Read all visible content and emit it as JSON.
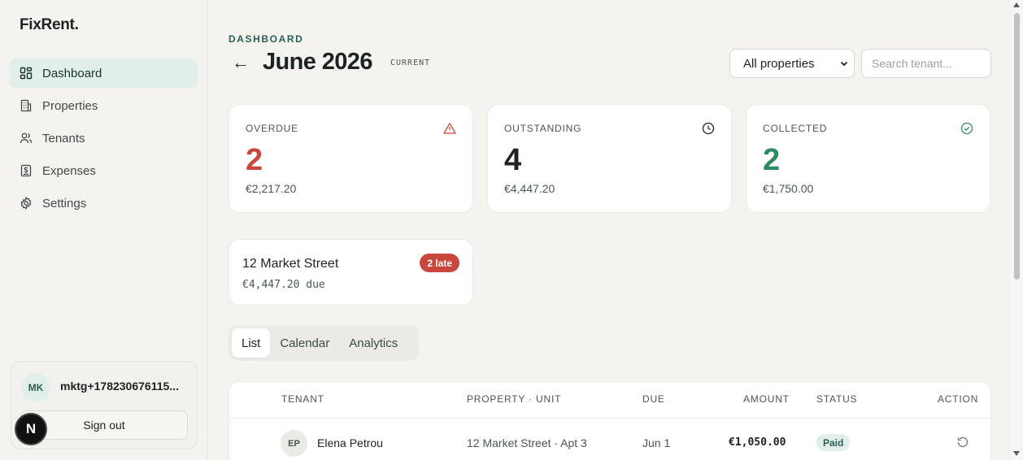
{
  "app": {
    "logo": "FixRent."
  },
  "sidebar": {
    "items": [
      {
        "label": "Dashboard",
        "icon": "dashboard-icon",
        "active": true
      },
      {
        "label": "Properties",
        "icon": "building-icon"
      },
      {
        "label": "Tenants",
        "icon": "users-icon"
      },
      {
        "label": "Expenses",
        "icon": "receipt-icon"
      },
      {
        "label": "Settings",
        "icon": "gear-icon"
      }
    ]
  },
  "user": {
    "initials": "MK",
    "email": "mktg+178230676115...",
    "signout_label": "Sign out",
    "framework_badge": "N"
  },
  "header": {
    "eyebrow": "DASHBOARD",
    "back": "←",
    "month": "June 2026",
    "current_tag": "CURRENT",
    "property_filter": "All properties",
    "search_placeholder": "Search tenant..."
  },
  "stats": [
    {
      "label": "OVERDUE",
      "count": "2",
      "amount": "€2,217.20",
      "icon": "alert-triangle-icon",
      "color": "#c9483e"
    },
    {
      "label": "OUTSTANDING",
      "count": "4",
      "amount": "€4,447.20",
      "icon": "clock-icon",
      "color": "#1c2321"
    },
    {
      "label": "COLLECTED",
      "count": "2",
      "amount": "€1,750.00",
      "icon": "check-circle-icon",
      "color": "#2e8a62"
    }
  ],
  "property_card": {
    "name": "12 Market Street",
    "badge": "2 late",
    "due": "€4,447.20 due"
  },
  "tabs": [
    {
      "label": "List",
      "active": true
    },
    {
      "label": "Calendar"
    },
    {
      "label": "Analytics"
    }
  ],
  "table": {
    "headers": {
      "tenant": "TENANT",
      "property": "PROPERTY · UNIT",
      "due": "DUE",
      "amount": "AMOUNT",
      "status": "STATUS",
      "action": "ACTION"
    },
    "rows": [
      {
        "initials": "EP",
        "tenant": "Elena Petrou",
        "property": "12 Market Street · Apt 3",
        "due": "Jun 1",
        "amount": "€1,050.00",
        "status": "Paid",
        "action_icon": "undo-icon"
      }
    ]
  },
  "colors": {
    "accent": "#2c5e54",
    "accent_bg": "#e2eeea",
    "danger": "#c9483e",
    "success": "#2e8a62"
  }
}
